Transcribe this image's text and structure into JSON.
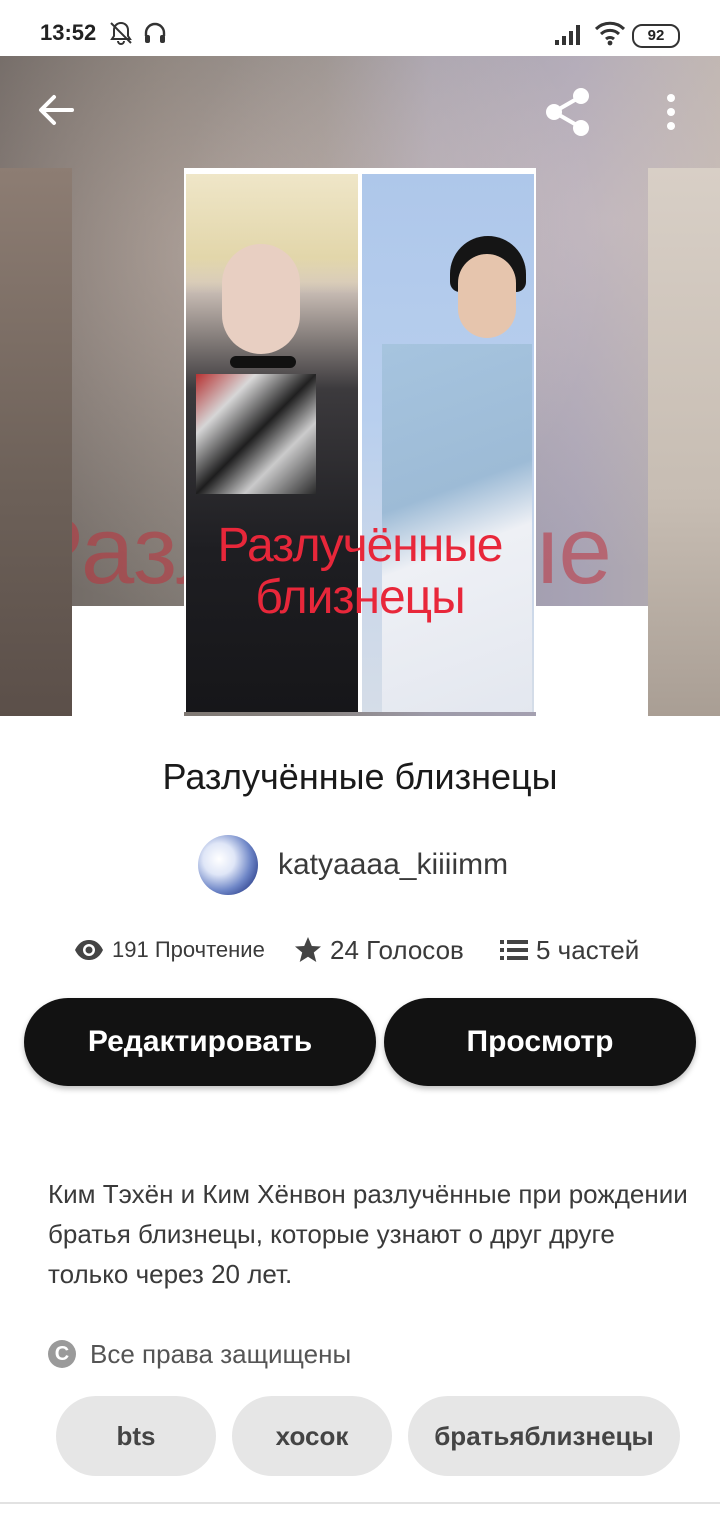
{
  "status_bar": {
    "time": "13:52",
    "battery": "92",
    "icons": [
      "bell-muted-icon",
      "headphones-icon",
      "signal-icon",
      "wifi-icon",
      "battery-icon"
    ]
  },
  "top_bar": {
    "back_icon": "arrow-left-icon",
    "share_icon": "share-icon",
    "menu_icon": "more-vertical-icon"
  },
  "cover": {
    "title_line1": "Разлучённые",
    "title_line2": "близнецы"
  },
  "story": {
    "title": "Разлучённые близнецы",
    "author": "katyaaaa_kiiiimm",
    "stats": {
      "reads": "191 Прочтение",
      "votes": "24 Голосов",
      "parts": "5 частей"
    },
    "buttons": {
      "edit": "Редактировать",
      "view": "Просмотр"
    },
    "description": "Ким Тэхён и Ким Хёнвон разлучённые при рождении братья близнецы, которые узнают о друг друге только через 20 лет.",
    "copyright": "Все права защищены",
    "tags": [
      "bts",
      "хосок",
      "братьяблизнецы"
    ]
  },
  "colors": {
    "button_bg": "#121212",
    "tag_bg": "#e6e6e6",
    "cover_title": "#e8273a"
  }
}
